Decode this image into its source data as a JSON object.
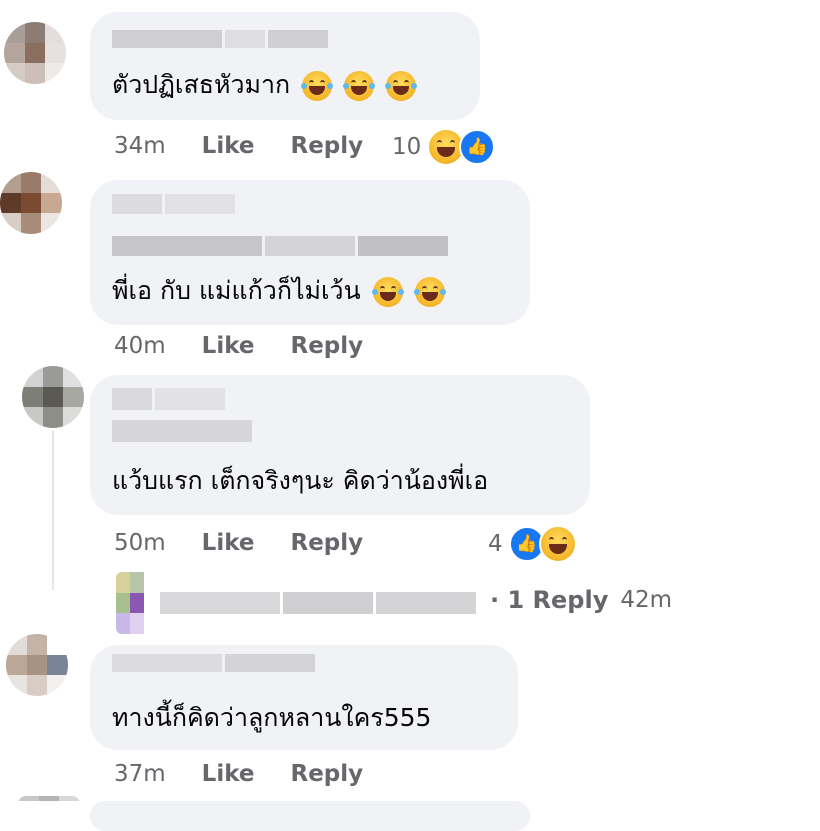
{
  "comments": [
    {
      "text": "ตัวปฏิเสธหัวมาก",
      "emoji_count": 3,
      "time": "34m",
      "like": "Like",
      "reply": "Reply",
      "reaction_count": "10"
    },
    {
      "text": "พี่เอ กับ แม่แก้วก็ไม่เว้น",
      "emoji_count": 2,
      "time": "40m",
      "like": "Like",
      "reply": "Reply"
    },
    {
      "text": "แว้บแรก เต็กจริงๆนะ คิดว่าน้องพี่เอ",
      "time": "50m",
      "like": "Like",
      "reply": "Reply",
      "reaction_count": "4",
      "replies_label": "· 1 Reply",
      "replies_time": "42m"
    },
    {
      "text": "ทางนี้ก็คิดว่าลูกหลานใคร555",
      "time": "37m",
      "like": "Like",
      "reply": "Reply"
    }
  ],
  "colors": {
    "bubble": "#f0f2f5",
    "meta_text": "#65676b",
    "like_blue": "#1877f2"
  },
  "icons": [
    "laughing-emoji-icon",
    "like-reaction-icon",
    "haha-reaction-icon"
  ]
}
